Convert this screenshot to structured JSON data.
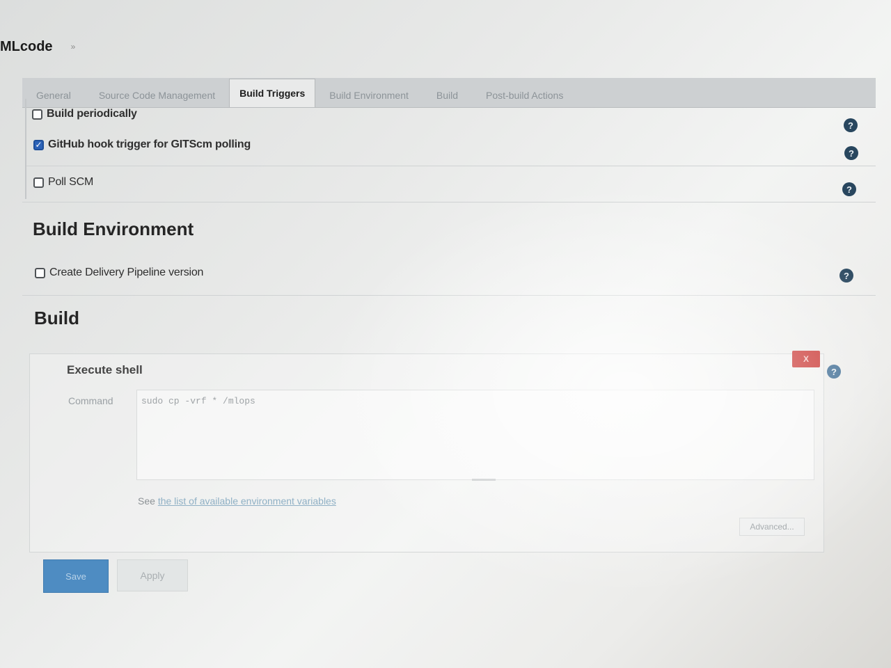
{
  "breadcrumb": {
    "project": "MLcode",
    "separator": "»"
  },
  "tabs": [
    {
      "label": "General",
      "active": false
    },
    {
      "label": "Source Code Management",
      "active": false
    },
    {
      "label": "Build Triggers",
      "active": true
    },
    {
      "label": "Build Environment",
      "active": false
    },
    {
      "label": "Build",
      "active": false
    },
    {
      "label": "Post-build Actions",
      "active": false
    }
  ],
  "build_triggers": {
    "options": [
      {
        "label": "Build periodically",
        "checked": false
      },
      {
        "label": "GitHub hook trigger for GITScm polling",
        "checked": true
      },
      {
        "label": "Poll SCM",
        "checked": false
      }
    ]
  },
  "build_environment": {
    "heading": "Build Environment",
    "options": [
      {
        "label": "Create Delivery Pipeline version",
        "checked": false
      }
    ]
  },
  "build": {
    "heading": "Build",
    "step_title": "Execute shell",
    "delete_label": "X",
    "command_label": "Command",
    "command_value": "sudo cp -vrf * /mlops",
    "env_vars_prefix": "See ",
    "env_vars_link": "the list of available environment variables",
    "advanced_label": "Advanced..."
  },
  "actions": {
    "save_label": "Save",
    "apply_label": "Apply"
  },
  "icons": {
    "help": "help-question-icon",
    "checkmark": "checkmark-icon"
  },
  "colors": {
    "checked_checkbox": "#2c63b8",
    "save_button": "#4e8cc2",
    "delete_button": "#c8312e",
    "help_icon": "#28465e"
  }
}
